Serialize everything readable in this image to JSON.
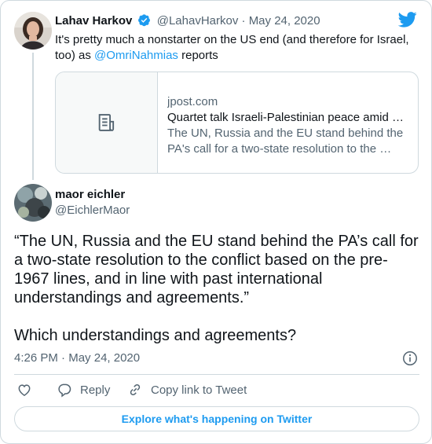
{
  "colors": {
    "accent": "#1d9bf0",
    "secondary_text": "#536471",
    "border": "#cfd9de"
  },
  "parent_tweet": {
    "author_name": "Lahav Harkov",
    "verified_icon": "verified-badge-icon",
    "handle": "@LahavHarkov",
    "separator": "·",
    "date": "May 24, 2020",
    "text_before": "It's pretty much a nonstarter on the US end (and therefore for Israel, too) as ",
    "mention": "@OmriNahmias",
    "text_after": " reports",
    "link_card": {
      "icon": "article-icon",
      "domain": "jpost.com",
      "title": "Quartet talk Israeli-Palestinian peace amid …",
      "description": "The UN, Russia and the EU stand behind the PA's call for a two-state resolution to the …"
    }
  },
  "main_tweet": {
    "author_name": "maor eichler",
    "handle": "@EichlerMaor",
    "paragraphs": [
      "“The UN, Russia and the EU stand behind the PA’s call for a two-state resolution to the conflict based on the pre-1967 lines, and in line with past international understandings and agreements.”",
      "Which understandings and agreements?"
    ],
    "time": "4:26 PM",
    "separator": "·",
    "date": "May 24, 2020"
  },
  "actions": {
    "like_icon": "heart-icon",
    "reply_label": "Reply",
    "copy_link_label": "Copy link to Tweet"
  },
  "explore_label": "Explore what's happening on Twitter",
  "brand_icon": "twitter-bird-icon"
}
